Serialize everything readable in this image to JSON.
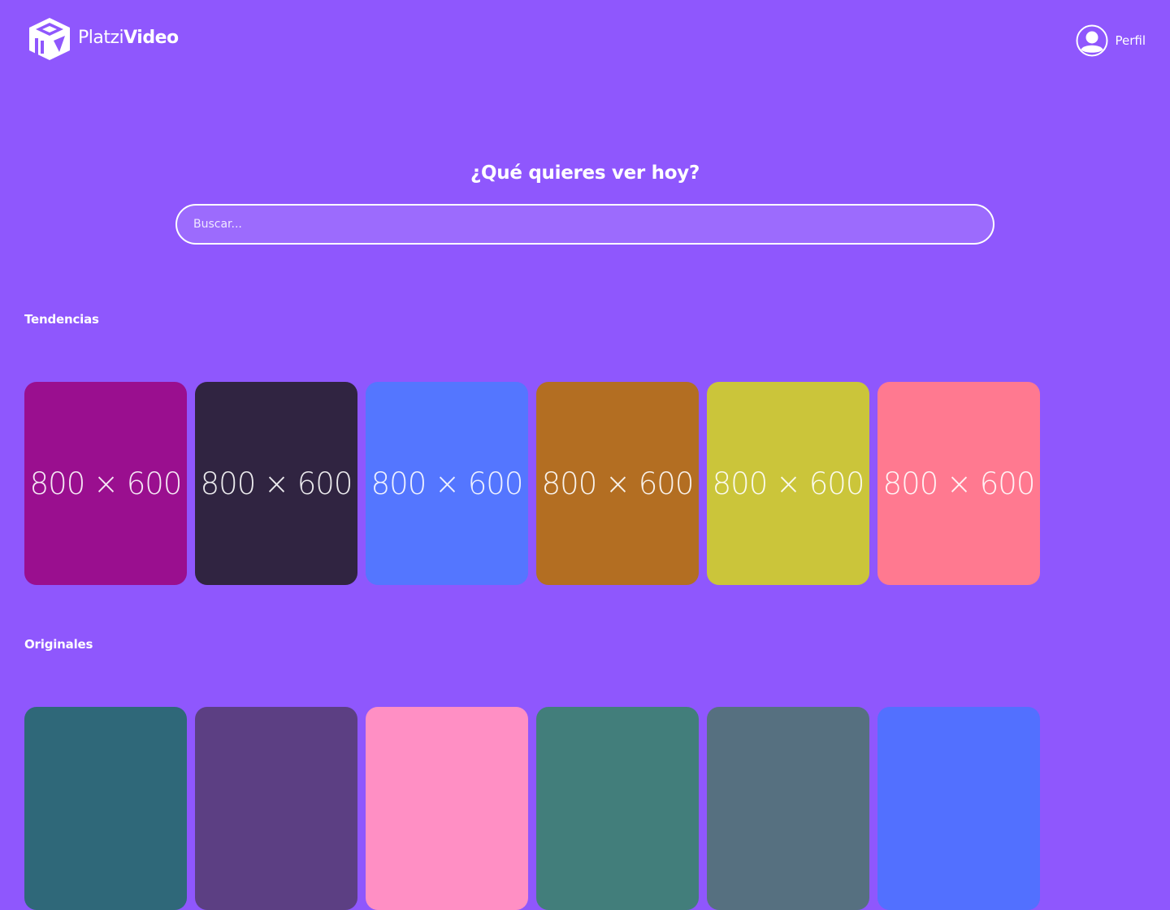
{
  "header": {
    "logo_light": "Platzi",
    "logo_bold": "Video",
    "profile_label": "Perfil"
  },
  "hero": {
    "title": "¿Qué quieres ver hoy?"
  },
  "search": {
    "placeholder": "Buscar..."
  },
  "sections": [
    {
      "title": "Tendencias",
      "cards": [
        {
          "text": "800 × 600",
          "color": "#9a0f8f"
        },
        {
          "text": "800 × 600",
          "color": "#302441"
        },
        {
          "text": "800 × 600",
          "color": "#5476ff"
        },
        {
          "text": "800 × 600",
          "color": "#b36e22"
        },
        {
          "text": "800 × 600",
          "color": "#cbc53a"
        },
        {
          "text": "800 × 600",
          "color": "#ff7990"
        }
      ]
    },
    {
      "title": "Originales",
      "cards": [
        {
          "text": "",
          "color": "#2f6879"
        },
        {
          "text": "",
          "color": "#5c3f83"
        },
        {
          "text": "",
          "color": "#ff8fc4"
        },
        {
          "text": "",
          "color": "#427e7b"
        },
        {
          "text": "",
          "color": "#567080"
        },
        {
          "text": "",
          "color": "#5270ff"
        }
      ]
    }
  ],
  "colors": {
    "background": "#8f57fd",
    "text": "#ffffff"
  },
  "icons": {
    "logo": "platzi-video-cube-icon",
    "profile": "user-avatar-icon"
  }
}
